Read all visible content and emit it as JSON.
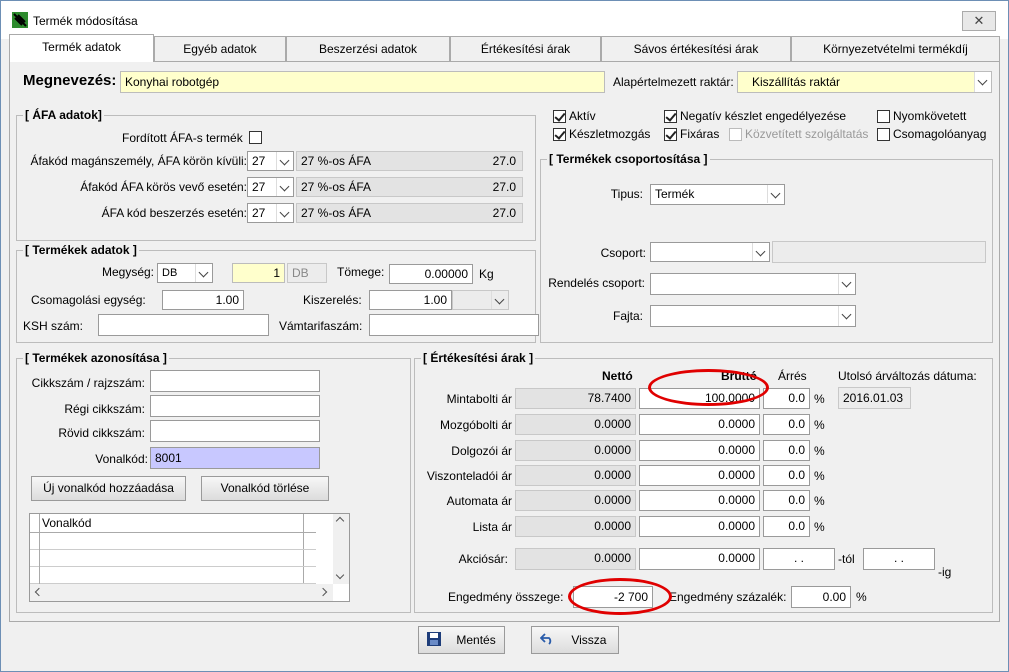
{
  "window": {
    "title": "Termék módosítása",
    "close_label": "✕"
  },
  "tabs": [
    {
      "label": "Termék adatok"
    },
    {
      "label": "Egyéb adatok"
    },
    {
      "label": "Beszerzési adatok"
    },
    {
      "label": "Értékesítési árak"
    },
    {
      "label": "Sávos értékesítési árak"
    },
    {
      "label": "Környezetvételmi termékdíj"
    }
  ],
  "header": {
    "name_label": "Megnevezés:",
    "name_value": "Konyhai robotgép",
    "warehouse_label": "Alapértelmezett raktár:",
    "warehouse_value": "Kiszállítás raktár"
  },
  "vat": {
    "title": "[  ÁFA adatok]",
    "reverse_label": "Fordított ÁFA-s termék",
    "rows": [
      {
        "label": "Áfakód magánszemély, ÁFA körön kívüli:",
        "code": "27",
        "desc": "27 %-os ÁFA",
        "rate": "27.0"
      },
      {
        "label": "Áfakód ÁFA körös vevő esetén:",
        "code": "27",
        "desc": "27 %-os ÁFA",
        "rate": "27.0"
      },
      {
        "label": "ÁFA kód beszerzés esetén:",
        "code": "27",
        "desc": "27 %-os ÁFA",
        "rate": "27.0"
      }
    ]
  },
  "flags": {
    "aktiv": "Aktív",
    "negativ": "Negatív készlet engedélyezése",
    "nyomkovetett": "Nyomkövetett",
    "keszletmozgas": "Készletmozgás",
    "fixaras": "Fixáras",
    "kozvetitett": "Közvetített szolgáltatás",
    "csomagoloanyag": "Csomagolóanyag"
  },
  "product_data": {
    "title": "[  Termékek adatok ]",
    "unit_label": "Megység:",
    "unit_value": "DB",
    "qty_value": "1",
    "qty_unit": "DB",
    "weight_label": "Tömege:",
    "weight_value": "0.00000",
    "weight_unit": "Kg",
    "pack_label": "Csomagolási egység:",
    "pack_value": "1.00",
    "kiszereles_label": "Kiszerelés:",
    "kiszereles_value": "1.00",
    "ksh_label": "KSH szám:",
    "ksh_value": "",
    "vam_label": "Vámtarifaszám:",
    "vam_value": ""
  },
  "grouping": {
    "title": "[  Termékek csoportosítása  ]",
    "type_label": "Tipus:",
    "type_value": "Termék",
    "group_label": "Csoport:",
    "order_group_label": "Rendelés csoport:",
    "kind_label": "Fajta:"
  },
  "identification": {
    "title": "[  Termékek azonosítása  ]",
    "cikkszam_label": "Cikkszám / rajzszám:",
    "regi_label": "Régi cikkszám:",
    "rovid_label": "Rövid cikkszám:",
    "vonalkod_label": "Vonalkód:",
    "vonalkod_value": "8001",
    "add_barcode": "Új vonalkód hozzáadása",
    "delete_barcode": "Vonalkód törlése",
    "grid_header": "Vonalkód"
  },
  "prices": {
    "title": "[  Értékesítési árak ]",
    "col_netto": "Nettó",
    "col_brutto": "Bruttó",
    "col_arres": "Árrés",
    "last_change_label": "Utolsó árváltozás dátuma:",
    "last_change_value": "2016.01.03",
    "pct": "%",
    "rows": [
      {
        "label": "Mintabolti ár",
        "net": "78.7400",
        "gross": "100.0000",
        "margin": "0.0"
      },
      {
        "label": "Mozgóbolti ár",
        "net": "0.0000",
        "gross": "0.0000",
        "margin": "0.0"
      },
      {
        "label": "Dolgozói ár",
        "net": "0.0000",
        "gross": "0.0000",
        "margin": "0.0"
      },
      {
        "label": "Viszonteladói ár",
        "net": "0.0000",
        "gross": "0.0000",
        "margin": "0.0"
      },
      {
        "label": "Automata ár",
        "net": "0.0000",
        "gross": "0.0000",
        "margin": "0.0"
      },
      {
        "label": "Lista ár",
        "net": "0.0000",
        "gross": "0.0000",
        "margin": "0.0"
      }
    ],
    "akcio_label": "Akciósár:",
    "akcio_net": "0.0000",
    "akcio_gross": "0.0000",
    "from_date": ". .",
    "from_label": "-tól",
    "to_date": ". .",
    "to_label": "-ig",
    "discount_label": "Engedmény összege:",
    "discount_value": "-2 700",
    "discount_pct_label": "Engedmény százalék:",
    "discount_pct_value": "0.00"
  },
  "footer": {
    "save_label": "Mentés",
    "back_label": "Vissza"
  },
  "colors": {
    "highlight_oval": "#e00000",
    "name_field": "#ffffcc",
    "barcode_field": "#c8c8ff"
  }
}
